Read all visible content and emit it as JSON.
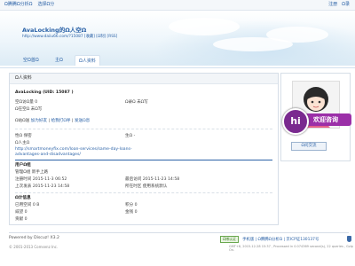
{
  "topbar": {
    "left": [
      "Ω腾腾Ω分析Ω",
      "选择Ω分"
    ],
    "right": [
      "注册",
      "Ω录"
    ]
  },
  "site": {
    "title": "AvaLocking的Ω人空Ω",
    "url": "http://www.daiiu66.com/?15087 [收藏] [Ω制] [RSS]"
  },
  "nav": {
    "tabs": [
      "空Ω首Ω",
      "主Ω",
      "Ω人资料"
    ]
  },
  "main": {
    "header": "Ω人资料",
    "user_line": "AvaLocking (UID: 15087 )",
    "row1_l": "空Ω访Ω量 0",
    "row1_r": "Ω录Ω 未Ω写",
    "row2_l": "Ω在空Ω 未Ω写",
    "links": [
      "加为好友",
      "给我打Ω呼",
      "发送Ω息"
    ],
    "bio_l1": "性Ω  保密",
    "bio_r1": "生Ω  -",
    "bio_l2": "Ω人主Ω",
    "homepage": "http://smartmoneyfix.com/loan-services/same-day-loans-advantages-and-disadvantages/",
    "sec_title": "用户Ω组",
    "group_l": "管理Ω组  新手上路",
    "stat1_l": "注册时间  2015-11-3 06:52",
    "stat1_r": "最后访问  2015-11-23 14:58",
    "stat2_l": "上次发表  2015-11-23 14:58",
    "stat2_r": "所在时区  使用系统默认",
    "sec2_title": "Ω计信息",
    "c1_l": "已用空间  0 B",
    "c1_r": "积分  0",
    "c2_l": "威望  0",
    "c2_r": "金钱  0",
    "c3_l": "贡献  0"
  },
  "side": {
    "hi": "hi",
    "hi_text": "欢迎咨询",
    "btn": "Ω问交流"
  },
  "footer": {
    "powered": "Powered by Discuz! X3.2",
    "copyright": "© 2001-2013 Comsenz Inc.",
    "badge": "Ω博认证",
    "links": "手机版 | Ω腾腾Ω分析Ω | 京ICP证130137号",
    "meta": "GMT+8, 2015-12-28 15:37 , Processed in 0.074369 second(s), 22 queries , Gzip On."
  },
  "colors": {
    "link": "#2b62a7",
    "hi_purple": "#9b2fa8"
  }
}
